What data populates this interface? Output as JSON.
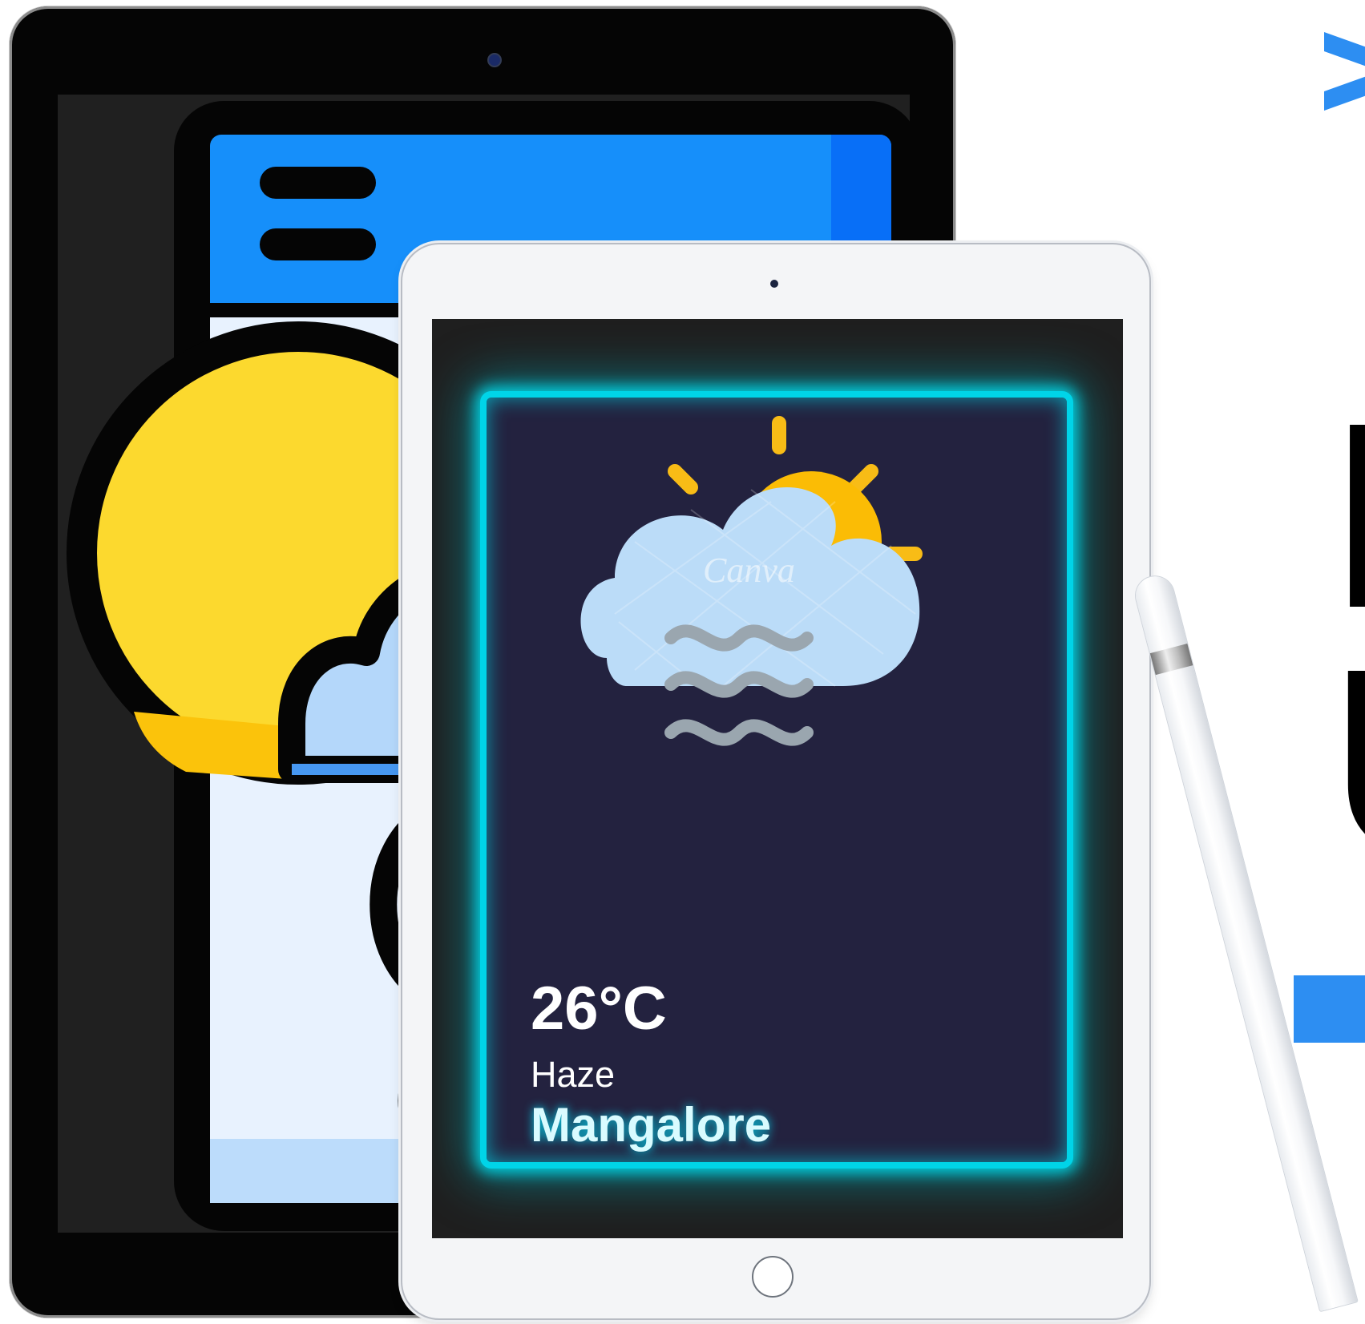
{
  "weather": {
    "temperature": "26°C",
    "condition": "Haze",
    "city": "Mangalore",
    "icon": "sun-cloud-haze-icon",
    "watermark": "Canva"
  },
  "right_panel": {
    "letters": [
      "I",
      "U"
    ]
  },
  "colors": {
    "primary_blue": "#168ffa",
    "neon_cyan": "#00d4e8",
    "card_background": "#23223f",
    "sun_yellow": "#fbbc05",
    "cloud_blue": "#bbdcf8"
  }
}
